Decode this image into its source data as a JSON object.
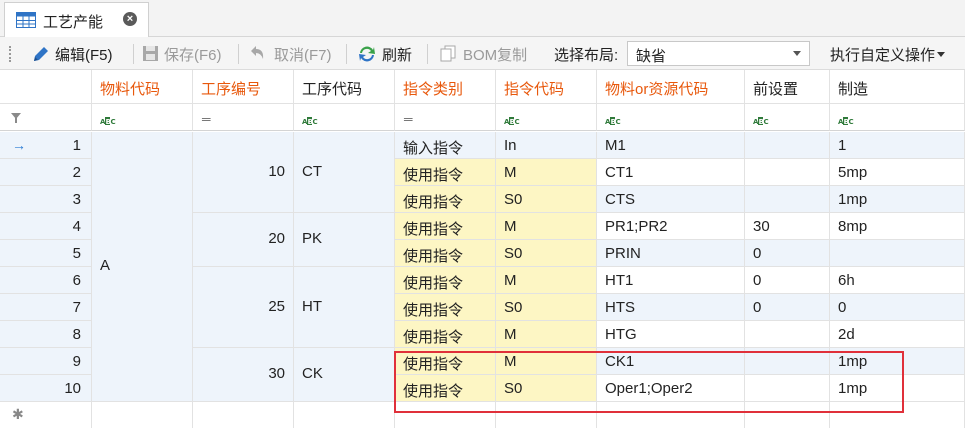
{
  "tab": {
    "title": "工艺产能",
    "close": "×",
    "icon": "table-icon"
  },
  "toolbar": {
    "edit": "编辑(F5)",
    "save": "保存(F6)",
    "cancel": "取消(F7)",
    "refresh": "刷新",
    "bom_copy": "BOM复制",
    "layout_label": "选择布局:",
    "layout_value": "缺省",
    "custom_ops": "执行自定义操作"
  },
  "columns": [
    {
      "label": "物料代码",
      "highlight": true,
      "filter": "abc"
    },
    {
      "label": "工序编号",
      "highlight": true,
      "filter": "eq"
    },
    {
      "label": "工序代码",
      "highlight": false,
      "filter": "abc"
    },
    {
      "label": "指令类别",
      "highlight": true,
      "filter": "eq"
    },
    {
      "label": "指令代码",
      "highlight": true,
      "filter": "abc"
    },
    {
      "label": "物料or资源代码",
      "highlight": true,
      "filter": "abc"
    },
    {
      "label": "前设置",
      "highlight": false,
      "filter": "abc"
    },
    {
      "label": "制造",
      "highlight": false,
      "filter": "abc"
    }
  ],
  "filter_eq_symbol": "═",
  "new_row_symbol": "✱",
  "current_row_symbol": "→",
  "groups": {
    "material": [
      {
        "value": "A"
      }
    ],
    "operations": [
      {
        "op_no": "10",
        "op_code": "CT"
      },
      {
        "op_no": "20",
        "op_code": "PK"
      },
      {
        "op_no": "25",
        "op_code": "HT"
      },
      {
        "op_no": "30",
        "op_code": "CK"
      }
    ]
  },
  "rows": [
    {
      "n": "1",
      "type": "输入指令",
      "code": "In",
      "res": "M1",
      "pre": "",
      "mfg": "1"
    },
    {
      "n": "2",
      "type": "使用指令",
      "code": "M",
      "res": "CT1",
      "pre": "",
      "mfg": "5mp"
    },
    {
      "n": "3",
      "type": "使用指令",
      "code": "S0",
      "res": "CTS",
      "pre": "",
      "mfg": "1mp"
    },
    {
      "n": "4",
      "type": "使用指令",
      "code": "M",
      "res": "PR1;PR2",
      "pre": "30",
      "mfg": "8mp"
    },
    {
      "n": "5",
      "type": "使用指令",
      "code": "S0",
      "res": "PRIN",
      "pre": "0",
      "mfg": ""
    },
    {
      "n": "6",
      "type": "使用指令",
      "code": "M",
      "res": "HT1",
      "pre": "0",
      "mfg": "6h"
    },
    {
      "n": "7",
      "type": "使用指令",
      "code": "S0",
      "res": "HTS",
      "pre": "0",
      "mfg": "0"
    },
    {
      "n": "8",
      "type": "使用指令",
      "code": "M",
      "res": "HTG",
      "pre": "",
      "mfg": "2d"
    },
    {
      "n": "9",
      "type": "使用指令",
      "code": "M",
      "res": "CK1",
      "pre": "",
      "mfg": "1mp"
    },
    {
      "n": "10",
      "type": "使用指令",
      "code": "S0",
      "res": "Oper1;Oper2",
      "pre": "",
      "mfg": "1mp"
    }
  ],
  "colors": {
    "header_red": "#e8580c",
    "blue_row": "#eef4fb",
    "yellow_col": "#fdf6c4",
    "highlight_box": "#e0303a"
  }
}
